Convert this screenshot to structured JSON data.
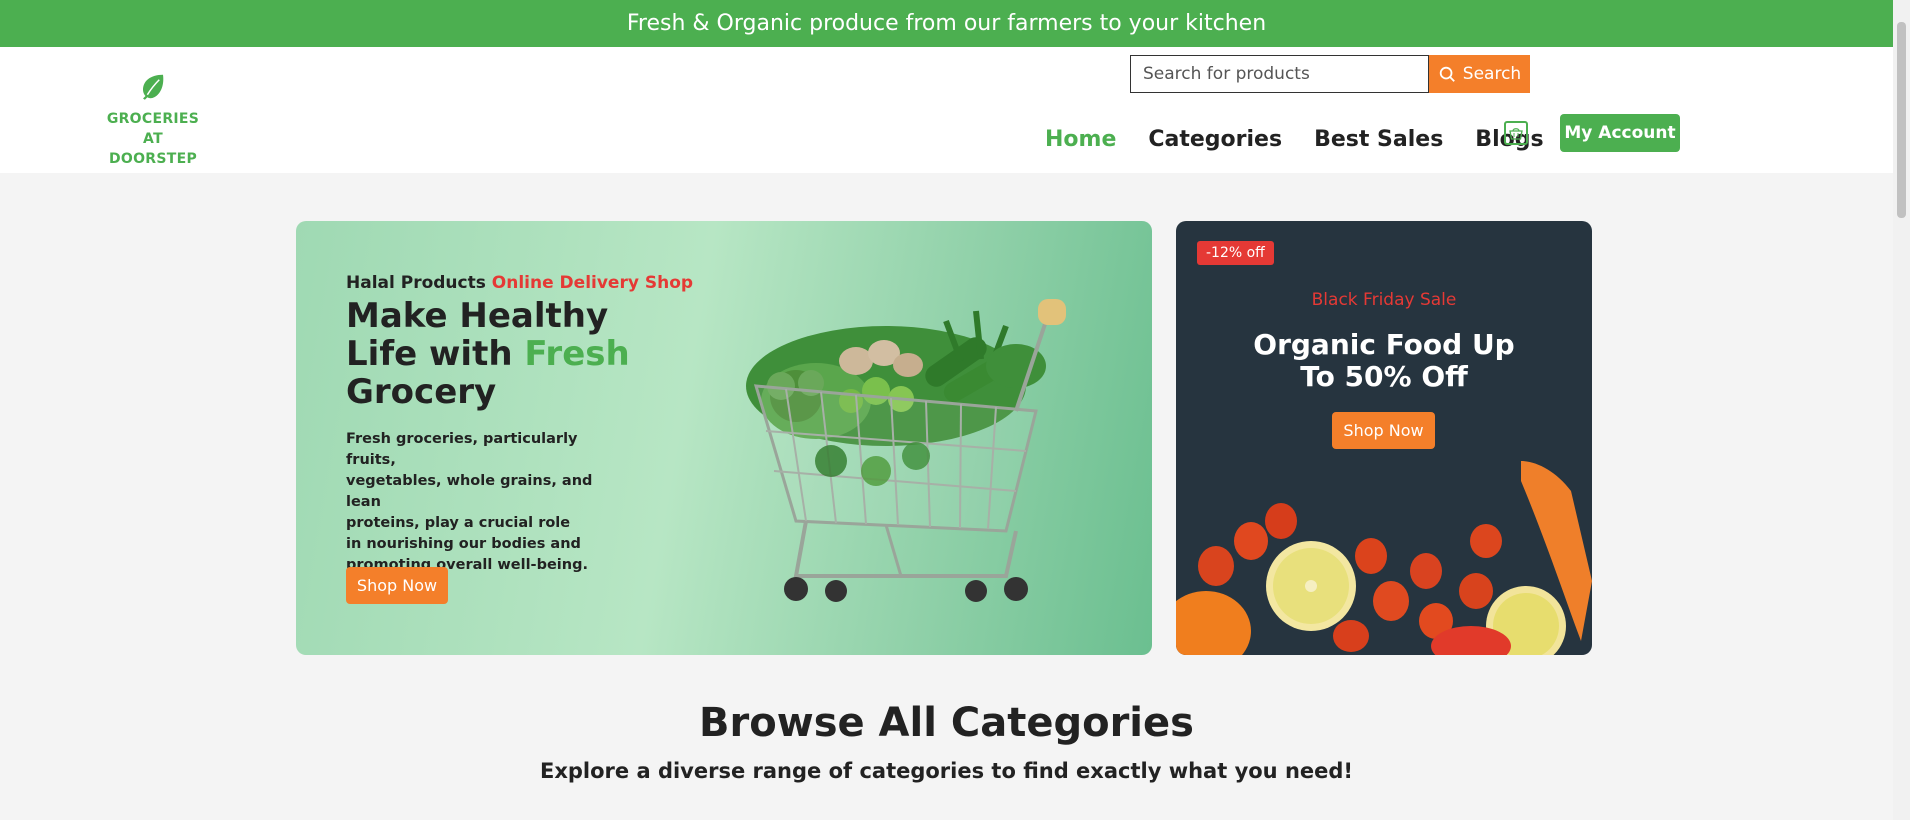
{
  "topbar": {
    "text": "Fresh & Organic produce from our farmers to your kitchen"
  },
  "logo": {
    "icon": "leaf-icon",
    "line1": "GROCERIES",
    "line2": "AT DOORSTEP"
  },
  "search": {
    "placeholder": "Search for products",
    "button_label": "Search"
  },
  "nav": {
    "items": [
      {
        "label": "Home",
        "active": true
      },
      {
        "label": "Categories",
        "active": false
      },
      {
        "label": "Best Sales",
        "active": false
      },
      {
        "label": "Blogs",
        "active": false
      }
    ],
    "cart_icon": "basket-icon",
    "account_label": "My Account"
  },
  "hero": {
    "kicker": "Halal Products",
    "kicker_highlight": "Online Delivery Shop",
    "title_part1": "Make Healthy Life with",
    "title_highlight": "Fresh",
    "title_part2": "Grocery",
    "description_lines": [
      "Fresh groceries, particularly fruits,",
      "vegetables, whole grains, and lean",
      "proteins, play a crucial role",
      "in nourishing our bodies and",
      "promoting overall well-being."
    ],
    "button_label": "Shop Now"
  },
  "promo": {
    "badge": "-12% off",
    "subtitle": "Black Friday Sale",
    "title_line1": "Organic Food Up",
    "title_line2": "To 50% Off",
    "button_label": "Shop Now"
  },
  "browse": {
    "title": "Browse All Categories",
    "subtitle": "Explore a diverse range of categories to find exactly what you need!"
  },
  "colors": {
    "brand_green": "#4caf50",
    "accent_orange": "#f47f2a",
    "accent_red": "#e53935",
    "promo_bg": "#26343f"
  }
}
